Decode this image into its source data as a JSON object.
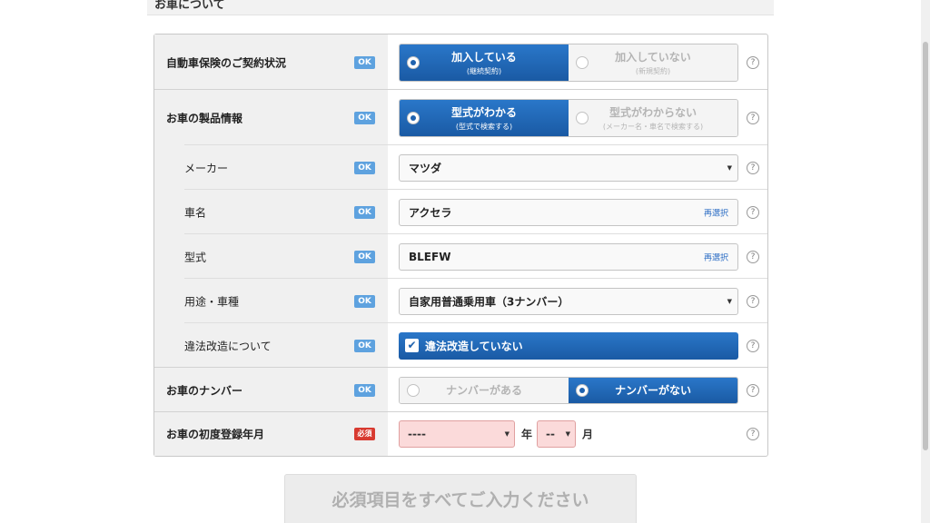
{
  "section_title": "お車について",
  "badges": {
    "ok": "OK",
    "required": "必須"
  },
  "help_glyph": "?",
  "rows": {
    "insurance": {
      "label": "自動車保険のご契約状況",
      "options": [
        {
          "title": "加入している",
          "sub": "(継続契約)",
          "selected": true
        },
        {
          "title": "加入していない",
          "sub": "(新規契約)",
          "selected": false
        }
      ]
    },
    "product": {
      "label": "お車の製品情報",
      "options": [
        {
          "title": "型式がわかる",
          "sub": "(型式で検索する)",
          "selected": true
        },
        {
          "title": "型式がわからない",
          "sub": "(メーカー名・車名で検索する)",
          "selected": false
        }
      ]
    },
    "maker": {
      "label": "メーカー",
      "value": "マツダ"
    },
    "car_name": {
      "label": "車名",
      "value": "アクセラ",
      "link": "再選択"
    },
    "model": {
      "label": "型式",
      "value": "BLEFW",
      "link": "再選択"
    },
    "usage": {
      "label": "用途・車種",
      "value": "自家用普通乗用車（3ナンバー）"
    },
    "modification": {
      "label": "違法改造について",
      "check_label": "違法改造していない",
      "checked": true
    },
    "plate": {
      "label": "お車のナンバー",
      "options": [
        {
          "title": "ナンバーがある",
          "selected": false
        },
        {
          "title": "ナンバーがない",
          "selected": true
        }
      ]
    },
    "registration": {
      "label": "お車の初度登録年月",
      "year_value": "----",
      "year_unit": "年",
      "month_value": "--",
      "month_unit": "月"
    }
  },
  "submit_label": "必須項目をすべてご入力ください",
  "colors": {
    "primary": "#1f62ae",
    "badge_ok": "#5ea2df",
    "badge_required": "#d83a30",
    "required_field": "#fbdada"
  }
}
